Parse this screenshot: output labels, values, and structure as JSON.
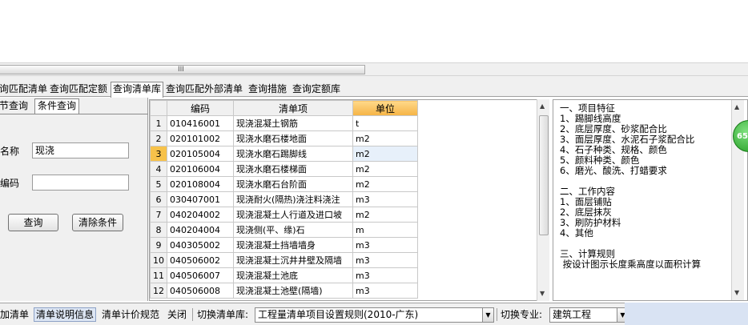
{
  "main_tabs": [
    {
      "label": "询匹配清单"
    },
    {
      "label": "查询匹配定额"
    },
    {
      "label": "查询清单库"
    },
    {
      "label": "查询匹配外部清单"
    },
    {
      "label": "查询措施"
    },
    {
      "label": "查询定额库"
    }
  ],
  "sub_tabs": [
    {
      "label": "节查询"
    },
    {
      "label": "条件查询"
    }
  ],
  "search": {
    "name_label": "名称",
    "name_value": "现浇",
    "code_label": "编码",
    "code_value": "",
    "query_button": "查询",
    "clear_button": "清除条件"
  },
  "grid": {
    "columns": [
      "编码",
      "清单项",
      "单位"
    ],
    "rows": [
      {
        "idx": "1",
        "code": "010416001",
        "item": "现浇混凝土钢筋",
        "unit": "t"
      },
      {
        "idx": "2",
        "code": "020101002",
        "item": "现浇水磨石楼地面",
        "unit": "m2"
      },
      {
        "idx": "3",
        "code": "020105004",
        "item": "现浇水磨石踢脚线",
        "unit": "m2"
      },
      {
        "idx": "4",
        "code": "020106004",
        "item": "现浇水磨石楼梯面",
        "unit": "m2"
      },
      {
        "idx": "5",
        "code": "020108004",
        "item": "现浇水磨石台阶面",
        "unit": "m2"
      },
      {
        "idx": "6",
        "code": "030407001",
        "item": "现浇耐火(隔热)浇注料浇注",
        "unit": "m3"
      },
      {
        "idx": "7",
        "code": "040204002",
        "item": "现浇混凝土人行道及进口坡",
        "unit": "m2"
      },
      {
        "idx": "8",
        "code": "040204004",
        "item": "现浇侧(平、缘)石",
        "unit": "m"
      },
      {
        "idx": "9",
        "code": "040305002",
        "item": "现浇混凝土挡墙墙身",
        "unit": "m3"
      },
      {
        "idx": "10",
        "code": "040506002",
        "item": "现浇混凝土沉井井壁及隔墙",
        "unit": "m3"
      },
      {
        "idx": "11",
        "code": "040506007",
        "item": "现浇混凝土池底",
        "unit": "m3"
      },
      {
        "idx": "12",
        "code": "040506008",
        "item": "现浇混凝土池壁(隔墙)",
        "unit": "m3"
      }
    ],
    "selected_row": 3
  },
  "description": [
    "一、项目特征",
    "1、踢脚线高度",
    "2、底层厚度、砂浆配合比",
    "3、面层厚度、水泥石子浆配合比",
    "4、石子种类、规格、颜色",
    "5、颜料种类、颜色",
    "6、磨光、酸洗、打蜡要求",
    "",
    "二、工作内容",
    "1、面层铺贴",
    "2、底层抹灰",
    "3、刷防护材料",
    "4、其他",
    "",
    "三、计算规则",
    " 按设计图示长度乘高度以面积计算"
  ],
  "badge": "65",
  "hscroll_grip": "III",
  "bottom": {
    "add_list": "加清单",
    "list_desc": "清单说明信息",
    "pricing_spec": "清单计价规范",
    "close": "关闭",
    "switch_lib_label": "切换清单库:",
    "switch_lib_value": "工程量清单项目设置规则(2010-广东)",
    "switch_major_label": "切换专业:",
    "switch_major_value": "建筑工程"
  },
  "colors": {
    "highlight_header": "#f5b445",
    "selected_row_idx": "#f7c24a",
    "badge": "#1f9a1f"
  }
}
